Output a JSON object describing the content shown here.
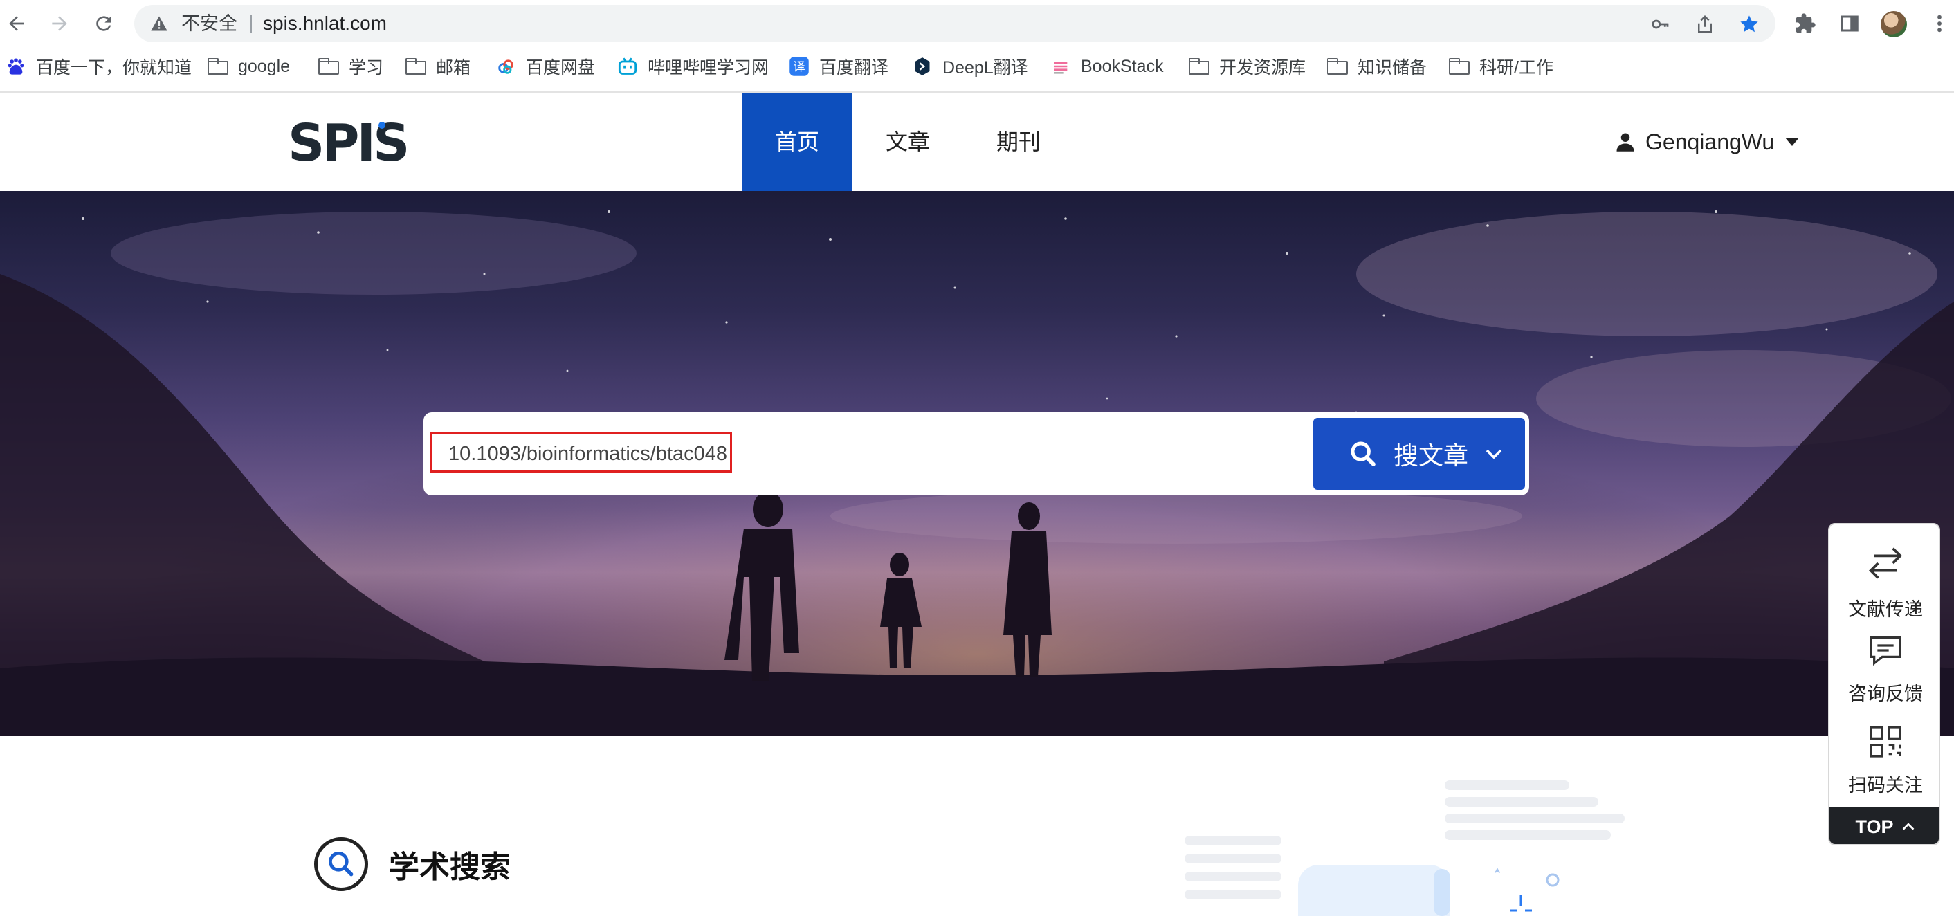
{
  "browser": {
    "security_label": "不安全",
    "url": "spis.hnlat.com",
    "icons": [
      "back-icon",
      "forward-icon",
      "reload-icon",
      "warning-icon",
      "key-icon",
      "share-icon",
      "bookmark-star-icon",
      "extensions-icon",
      "sidepanel-icon",
      "profile-avatar",
      "menu-icon"
    ]
  },
  "bookmarks": [
    {
      "label": "百度一下，你就知道",
      "icon": "baidu-icon"
    },
    {
      "label": "google",
      "icon": "folder-icon"
    },
    {
      "label": "学习",
      "icon": "folder-icon"
    },
    {
      "label": "邮箱",
      "icon": "folder-icon"
    },
    {
      "label": "百度网盘",
      "icon": "baidu-netdisk-icon"
    },
    {
      "label": "哔哩哔哩学习网",
      "icon": "bilibili-icon"
    },
    {
      "label": "百度翻译",
      "icon": "baidu-translate-icon"
    },
    {
      "label": "DeepL翻译",
      "icon": "deepl-icon"
    },
    {
      "label": "BookStack",
      "icon": "bookstack-icon"
    },
    {
      "label": "开发资源库",
      "icon": "folder-icon"
    },
    {
      "label": "知识储备",
      "icon": "folder-icon"
    },
    {
      "label": "科研/工作",
      "icon": "folder-icon"
    }
  ],
  "site": {
    "logo_text": "SPIS",
    "nav": [
      {
        "label": "首页",
        "active": true
      },
      {
        "label": "文章",
        "active": false
      },
      {
        "label": "期刊",
        "active": false
      }
    ],
    "user_name": "GenqiangWu"
  },
  "search": {
    "value": "10.1093/bioinformatics/btac048",
    "button_label": "搜文章"
  },
  "section": {
    "title": "学术搜索"
  },
  "side_panel": {
    "items": [
      {
        "label": "文献传递",
        "icon": "transfer-icon"
      },
      {
        "label": "咨询反馈",
        "icon": "feedback-icon"
      },
      {
        "label": "扫码关注",
        "icon": "qrcode-icon"
      }
    ],
    "top_label": "TOP"
  },
  "colors": {
    "accent": "#0d4fbd",
    "search_button": "#1a4fc4",
    "highlight": "#e02020"
  }
}
